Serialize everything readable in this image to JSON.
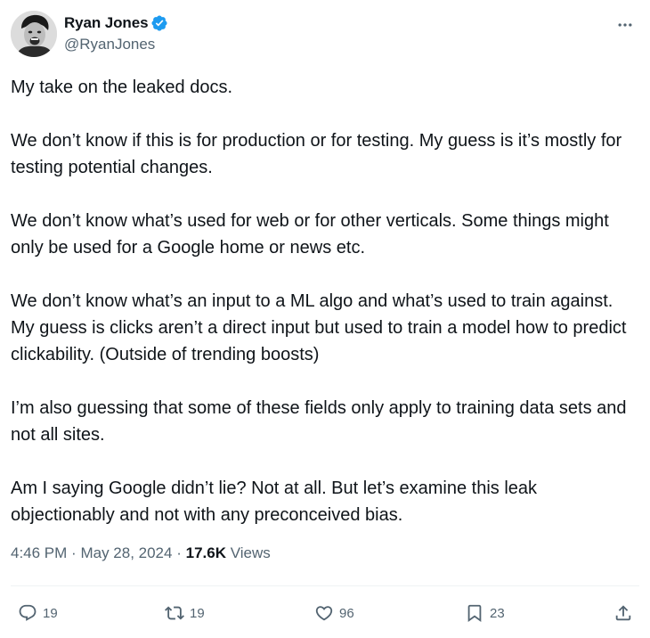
{
  "author": {
    "display_name": "Ryan Jones",
    "handle": "@RyanJones",
    "verified": true,
    "avatar_icon": "avatar-photo"
  },
  "tweet": {
    "paragraphs": [
      "My take on the leaked docs.",
      "We don’t know if this is for production or for testing. My guess is it’s mostly for testing potential changes.",
      "We don’t know what’s used for web or for other verticals. Some things might only be used for a Google home or news etc.",
      "We don’t know what’s an input to a ML algo and what’s used to train against. My guess is clicks aren’t a direct input but used to train a model how to predict clickability. (Outside of trending boosts)",
      "I’m also guessing that some of these fields only apply to training data sets and not all sites.",
      "Am I saying Google didn’t lie? Not at all. But let’s examine this leak objectionably and not with any preconceived bias."
    ],
    "time": "4:46 PM",
    "separator": "·",
    "date": "May 28, 2024",
    "views_count": "17.6K",
    "views_label": "Views"
  },
  "actions": {
    "replies": "19",
    "reposts": "19",
    "likes": "96",
    "bookmarks": "23"
  },
  "colors": {
    "text": "#0f1419",
    "secondary": "#536471",
    "verified": "#1d9bf0",
    "divider": "#eff3f4"
  },
  "icons": [
    "verified-badge-icon",
    "more-icon",
    "reply-icon",
    "repost-icon",
    "like-icon",
    "bookmark-icon",
    "share-icon"
  ]
}
